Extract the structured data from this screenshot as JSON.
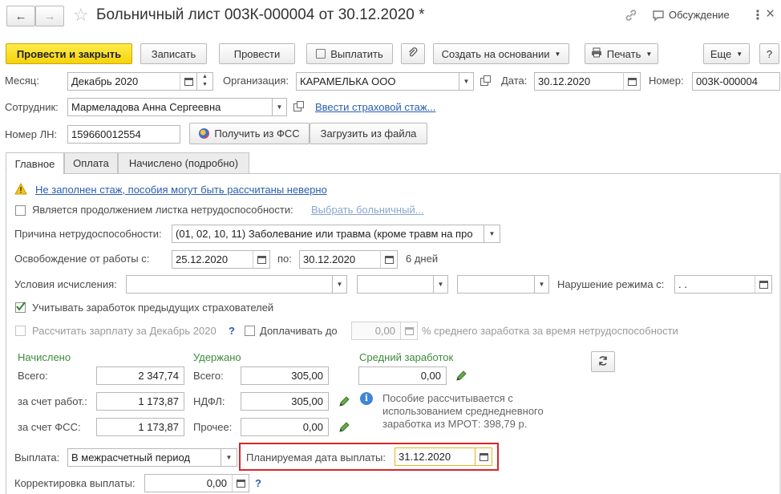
{
  "titlebar": {
    "title": "Больничный лист 003К-000004 от 30.12.2020 *",
    "discussion_label": "Обсуждение"
  },
  "toolbar": {
    "post_close": "Провести и закрыть",
    "save": "Записать",
    "post": "Провести",
    "pay": "Выплатить",
    "create_based": "Создать на основании",
    "print": "Печать",
    "more": "Еще",
    "help": "?"
  },
  "header": {
    "month_label": "Месяц:",
    "month_value": "Декабрь 2020",
    "org_label": "Организация:",
    "org_value": "КАРАМЕЛЬКА ООО",
    "date_label": "Дата:",
    "date_value": "30.12.2020",
    "number_label": "Номер:",
    "number_value": "003К-000004",
    "employee_label": "Сотрудник:",
    "employee_value": "Мармеладова Анна Сергеевна",
    "insurance_link": "Ввести страховой стаж...",
    "ln_label": "Номер ЛН:",
    "ln_value": "159660012554",
    "get_fss": "Получить из ФСС",
    "load_file": "Загрузить из файла"
  },
  "tabs": [
    {
      "label": "Главное",
      "active": true
    },
    {
      "label": "Оплата",
      "active": false
    },
    {
      "label": "Начислено (подробно)",
      "active": false
    }
  ],
  "main": {
    "warning_text": "Не заполнен стаж, пособия могут быть рассчитаны неверно",
    "continuation_label": "Является продолжением листка нетрудоспособности:",
    "continuation_checked": false,
    "choose_sick_link": "Выбрать больничный...",
    "reason_label": "Причина нетрудоспособности:",
    "reason_value": "(01, 02, 10, 11) Заболевание или травма (кроме травм на про",
    "release_label": "Освобождение от работы с:",
    "release_from": "25.12.2020",
    "release_to_label": "по:",
    "release_to": "30.12.2020",
    "days": "6 дней",
    "conditions_label": "Условия исчисления:",
    "violation_label": "Нарушение режима с:",
    "violation_value": " .  .",
    "prev_insurers_label": "Учитывать заработок предыдущих страхователей",
    "prev_insurers_checked": true,
    "calc_salary_label": "Рассчитать зарплату за Декабрь 2020",
    "calc_salary_help": "?",
    "extra_pay_label": "Доплачивать до",
    "extra_pay_value": "0,00",
    "extra_pay_suffix": "% среднего заработка за время нетрудоспособности"
  },
  "accrued": {
    "heading": "Начислено",
    "total_label": "Всего:",
    "total_value": "2 347,74",
    "employer_label": "за счет работ.:",
    "employer_value": "1 173,87",
    "fss_label": "за счет ФСС:",
    "fss_value": "1 173,87"
  },
  "withheld": {
    "heading": "Удержано",
    "total_label": "Всего:",
    "total_value": "305,00",
    "ndfl_label": "НДФЛ:",
    "ndfl_value": "305,00",
    "other_label": "Прочее:",
    "other_value": "0,00"
  },
  "average": {
    "heading": "Средний заработок",
    "value": "0,00",
    "info_text_1": "Пособие рассчитывается с",
    "info_text_2": "использованием среднедневного",
    "info_text_3": "заработка из МРОТ: 398,79 р."
  },
  "payment": {
    "label": "Выплата:",
    "value": "В межрасчетный период",
    "planned_label": "Планируемая дата выплаты:",
    "planned_value": "31.12.2020",
    "correction_label": "Корректировка выплаты:",
    "correction_value": "0,00",
    "help": "?"
  },
  "colors": {
    "primary_button": "#f5d20c",
    "highlight_border": "#d7262b",
    "link": "#2a5db0",
    "green_heading": "#3d8a3d"
  }
}
